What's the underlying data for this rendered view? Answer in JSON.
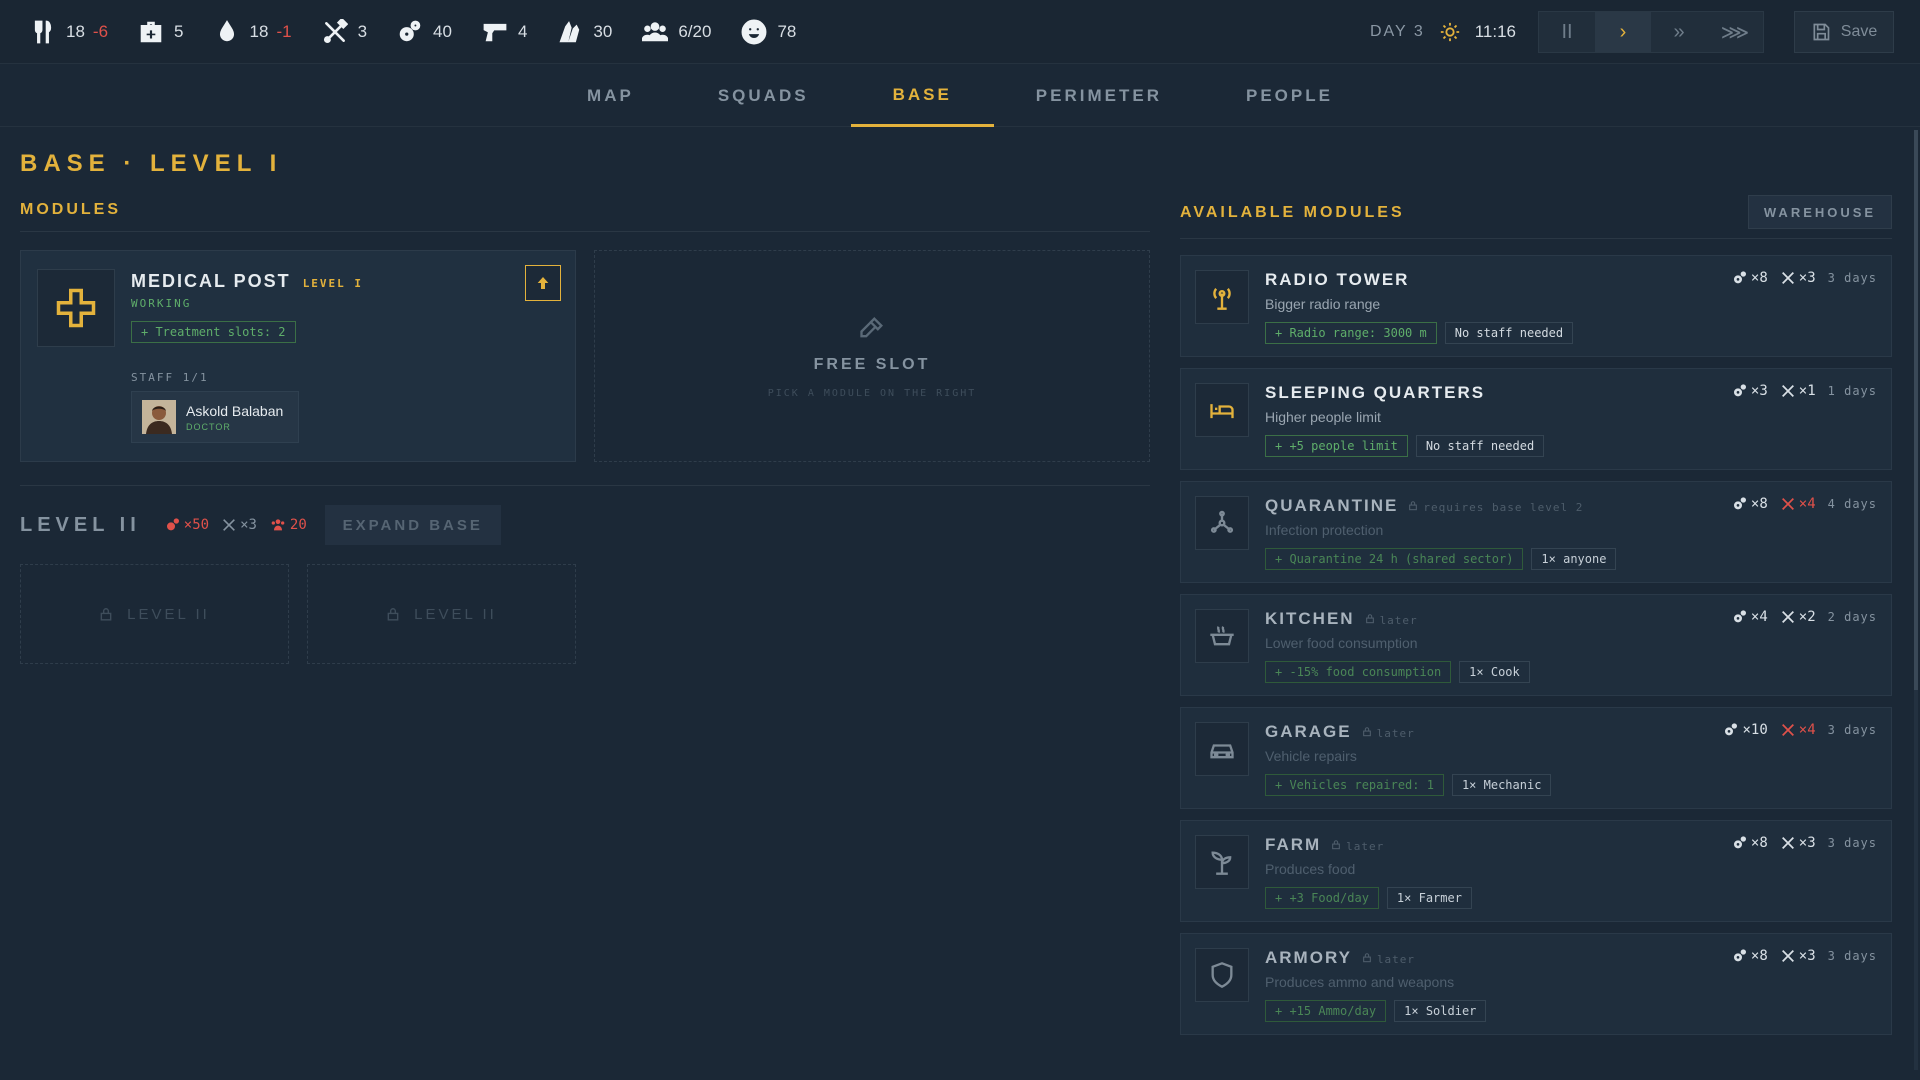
{
  "resources": [
    {
      "icon": "food-icon",
      "value": "18",
      "delta": "-6"
    },
    {
      "icon": "medkit-icon",
      "value": "5",
      "delta": ""
    },
    {
      "icon": "water-icon",
      "value": "18",
      "delta": "-1"
    },
    {
      "icon": "tools-icon",
      "value": "3",
      "delta": ""
    },
    {
      "icon": "parts-icon",
      "value": "40",
      "delta": ""
    },
    {
      "icon": "gun-icon",
      "value": "4",
      "delta": ""
    },
    {
      "icon": "ammo-icon",
      "value": "30",
      "delta": ""
    },
    {
      "icon": "people-icon",
      "value": "6/20",
      "delta": ""
    },
    {
      "icon": "morale-icon",
      "value": "78",
      "delta": ""
    }
  ],
  "time": {
    "day": "DAY 3",
    "clock": "11:16"
  },
  "speed": {
    "pause": "II",
    "play": "›",
    "fast": "»",
    "fastest": "⋙",
    "active": "play"
  },
  "save_label": "Save",
  "tabs": [
    "MAP",
    "SQUADS",
    "BASE",
    "PERIMETER",
    "PEOPLE"
  ],
  "active_tab": "BASE",
  "page_title": "BASE · LEVEL I",
  "modules": {
    "heading": "MODULES",
    "medical": {
      "name": "MEDICAL POST",
      "level": "LEVEL I",
      "status": "WORKING",
      "bonus": "+ Treatment slots: 2",
      "staff_label": "STAFF 1/1",
      "staff_name": "Askold Balaban",
      "staff_role": "DOCTOR"
    },
    "free_slot": {
      "title": "FREE SLOT",
      "hint": "PICK A MODULE ON THE RIGHT"
    }
  },
  "level2": {
    "title": "LEVEL II",
    "cost_parts": "×50",
    "cost_tools": "×3",
    "cost_people": "20",
    "expand_label": "EXPAND BASE",
    "slot_label": "LEVEL II"
  },
  "available": {
    "heading": "AVAILABLE MODULES",
    "warehouse_label": "WAREHOUSE",
    "items": [
      {
        "name": "RADIO TOWER",
        "lock": "",
        "desc": "Bigger radio range",
        "bonus": "+ Radio range: 3000 m",
        "staff": "No staff needed",
        "parts": "×8",
        "tools": "×3",
        "tools_red": false,
        "days": "3 days",
        "icon": "radio-tower-icon",
        "locked": false
      },
      {
        "name": "SLEEPING QUARTERS",
        "lock": "",
        "desc": "Higher people limit",
        "bonus": "+ +5 people limit",
        "staff": "No staff needed",
        "parts": "×3",
        "tools": "×1",
        "tools_red": false,
        "days": "1 days",
        "icon": "bed-icon",
        "locked": false
      },
      {
        "name": "QUARANTINE",
        "lock": "requires base level 2",
        "desc": "Infection protection",
        "bonus": "+ Quarantine 24 h (shared sector)",
        "staff": "1× anyone",
        "parts": "×8",
        "tools": "×4",
        "tools_red": true,
        "days": "4 days",
        "icon": "biohazard-icon",
        "locked": true
      },
      {
        "name": "KITCHEN",
        "lock": "later",
        "desc": "Lower food consumption",
        "bonus": "+ -15% food consumption",
        "staff": "1× Cook",
        "parts": "×4",
        "tools": "×2",
        "tools_red": false,
        "days": "2 days",
        "icon": "pot-icon",
        "locked": true
      },
      {
        "name": "GARAGE",
        "lock": "later",
        "desc": "Vehicle repairs",
        "bonus": "+ Vehicles repaired: 1",
        "staff": "1× Mechanic",
        "parts": "×10",
        "tools": "×4",
        "tools_red": true,
        "days": "3 days",
        "icon": "car-icon",
        "locked": true
      },
      {
        "name": "FARM",
        "lock": "later",
        "desc": "Produces food",
        "bonus": "+ +3 Food/day",
        "staff": "1× Farmer",
        "parts": "×8",
        "tools": "×3",
        "tools_red": false,
        "days": "3 days",
        "icon": "sprout-icon",
        "locked": true
      },
      {
        "name": "ARMORY",
        "lock": "later",
        "desc": "Produces ammo and weapons",
        "bonus": "+ +15 Ammo/day",
        "staff": "1× Soldier",
        "parts": "×8",
        "tools": "×3",
        "tools_red": false,
        "days": "3 days",
        "icon": "shield-icon",
        "locked": true
      }
    ]
  }
}
